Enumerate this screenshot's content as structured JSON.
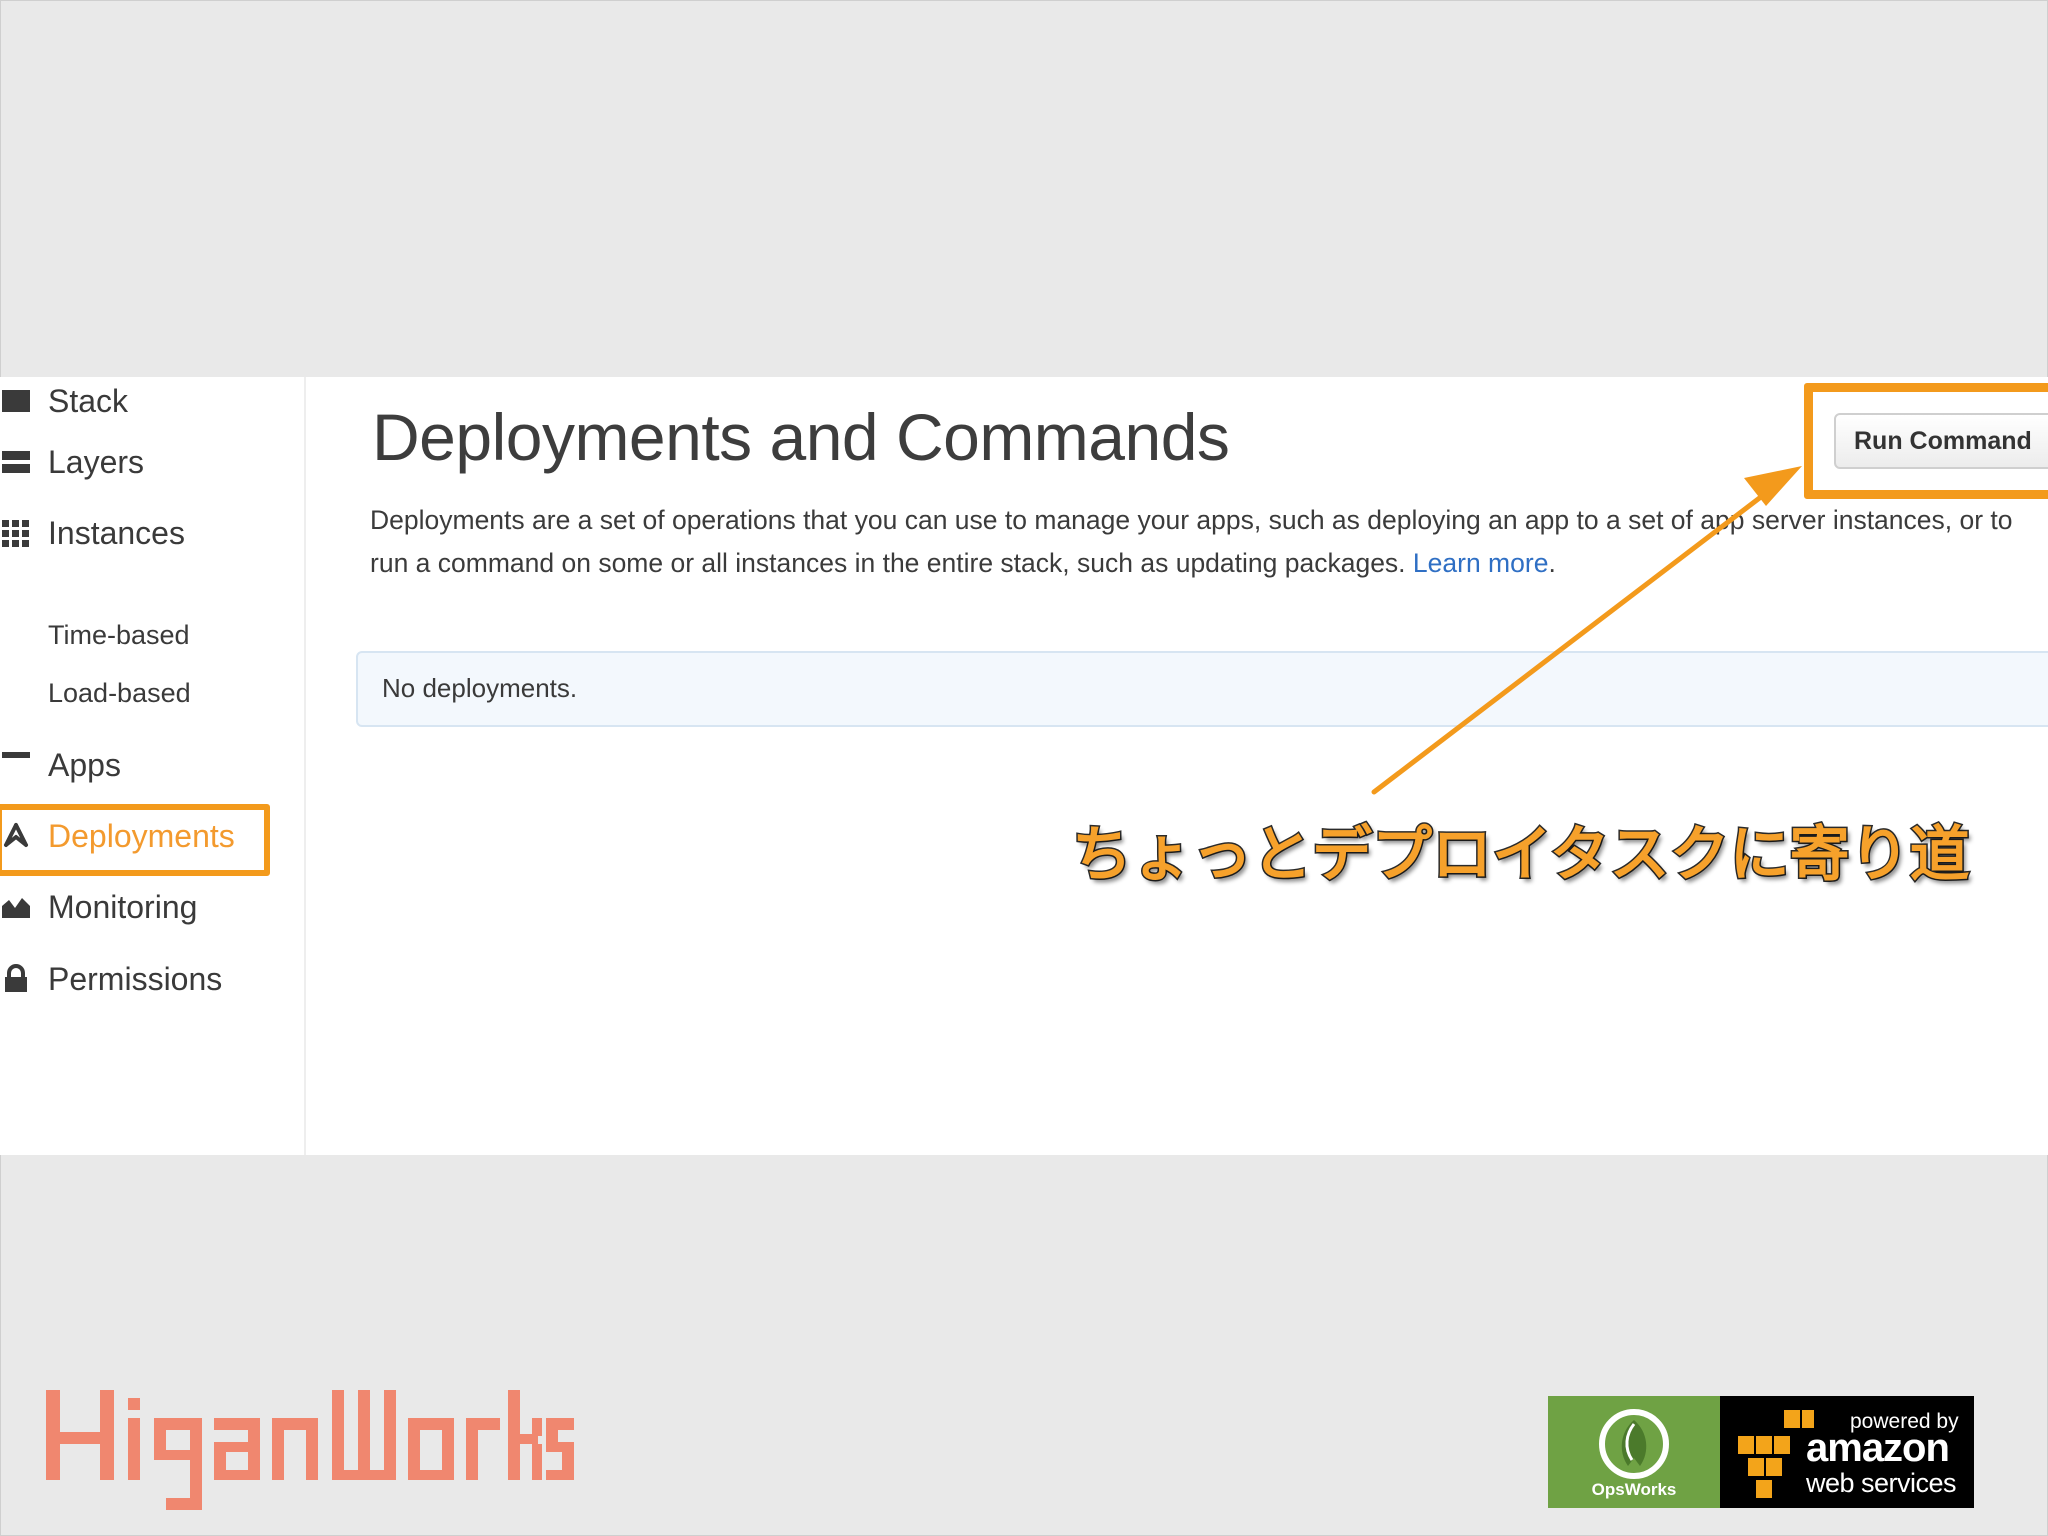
{
  "sidebar": {
    "items": [
      {
        "label": "Stack",
        "icon": "stack-icon"
      },
      {
        "label": "Layers",
        "icon": "layers-icon"
      },
      {
        "label": "Instances",
        "icon": "instances-grid-icon"
      },
      {
        "label": "Time-based",
        "icon": ""
      },
      {
        "label": "Load-based",
        "icon": ""
      },
      {
        "label": "Apps",
        "icon": "apps-icon"
      },
      {
        "label": "Deployments",
        "icon": "deployments-icon"
      },
      {
        "label": "Monitoring",
        "icon": "monitoring-icon"
      },
      {
        "label": "Permissions",
        "icon": "lock-icon"
      }
    ],
    "active": "Deployments"
  },
  "main": {
    "title": "Deployments and Commands",
    "description_line1": "Deployments are a set of operations that you can use to manage your apps, such as deploying an app to a set of app server instances, or to",
    "description_line2": "run a command on some or all instances in the entire stack, such as updating packages.",
    "learn_more": "Learn more",
    "period": ".",
    "empty_message": "No deployments.",
    "run_command_label": "Run Command"
  },
  "annotation": {
    "text": "ちょっとデプロイタスクに寄り道",
    "color": "#f6a12b"
  },
  "footer": {
    "brand_logo": "HiganWorks",
    "opsworks_label": "OpsWorks",
    "aws_powered_by": "powered by",
    "aws_amazon": "amazon",
    "aws_web_services": "web services"
  },
  "colors": {
    "highlight": "#f39a1c",
    "link": "#2f6fc4",
    "active_nav": "#f39a2e",
    "opsworks_green": "#6fa244",
    "brand_salmon": "#f0876f"
  }
}
